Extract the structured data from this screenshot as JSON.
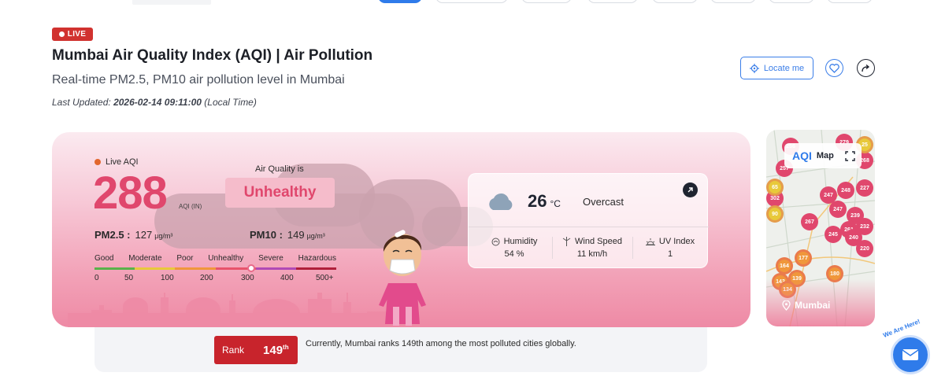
{
  "header": {
    "live_badge": "LIVE",
    "title": "Mumbai Air Quality Index (AQI) | Air Pollution",
    "subtitle": "Real-time PM2.5, PM10 air pollution level in Mumbai",
    "last_updated_label": "Last Updated:",
    "last_updated_value": "2026-02-14 09:11:00",
    "last_updated_suffix": "(Local Time)",
    "locate_button": "Locate me"
  },
  "aqi": {
    "live_label": "Live AQI",
    "value": "288",
    "unit": "AQI (IN)",
    "quality_label": "Air Quality is",
    "status": "Unhealthy",
    "pm25_label": "PM2.5 :",
    "pm25_value": "127",
    "pm10_label": "PM10 :",
    "pm10_value": "149",
    "pm_unit": "µg/m³",
    "scale_categories": [
      "Good",
      "Moderate",
      "Poor",
      "Unhealthy",
      "Severe",
      "Hazardous"
    ],
    "scale_numbers": [
      "0",
      "50",
      "100",
      "200",
      "300",
      "400",
      "500+"
    ],
    "scale_colors": [
      "#59b24a",
      "#e8c93a",
      "#f0973b",
      "#e8536b",
      "#b04ab5",
      "#b01f3a"
    ]
  },
  "weather": {
    "temperature": "26",
    "temperature_unit": "°C",
    "condition": "Overcast",
    "humidity_label": "Humidity",
    "humidity_value": "54 %",
    "wind_label": "Wind Speed",
    "wind_value": "11 km/h",
    "uv_label": "UV Index",
    "uv_value": "1"
  },
  "map": {
    "brand": "AQI",
    "label": "Map",
    "city": "Mumbai",
    "markers": [
      "279",
      "257",
      "268",
      "302",
      "247",
      "248",
      "227",
      "247",
      "239",
      "267",
      "245",
      "261",
      "232",
      "240",
      "220",
      "177",
      "164",
      "139",
      "143",
      "134",
      "180",
      "65",
      "90",
      "25",
      "256"
    ]
  },
  "rank": {
    "label": "Rank",
    "number": "149",
    "suffix": "th",
    "text": "Currently, Mumbai ranks 149th among the most polluted cities globally."
  },
  "chat": {
    "tag": "We Are Here!"
  }
}
